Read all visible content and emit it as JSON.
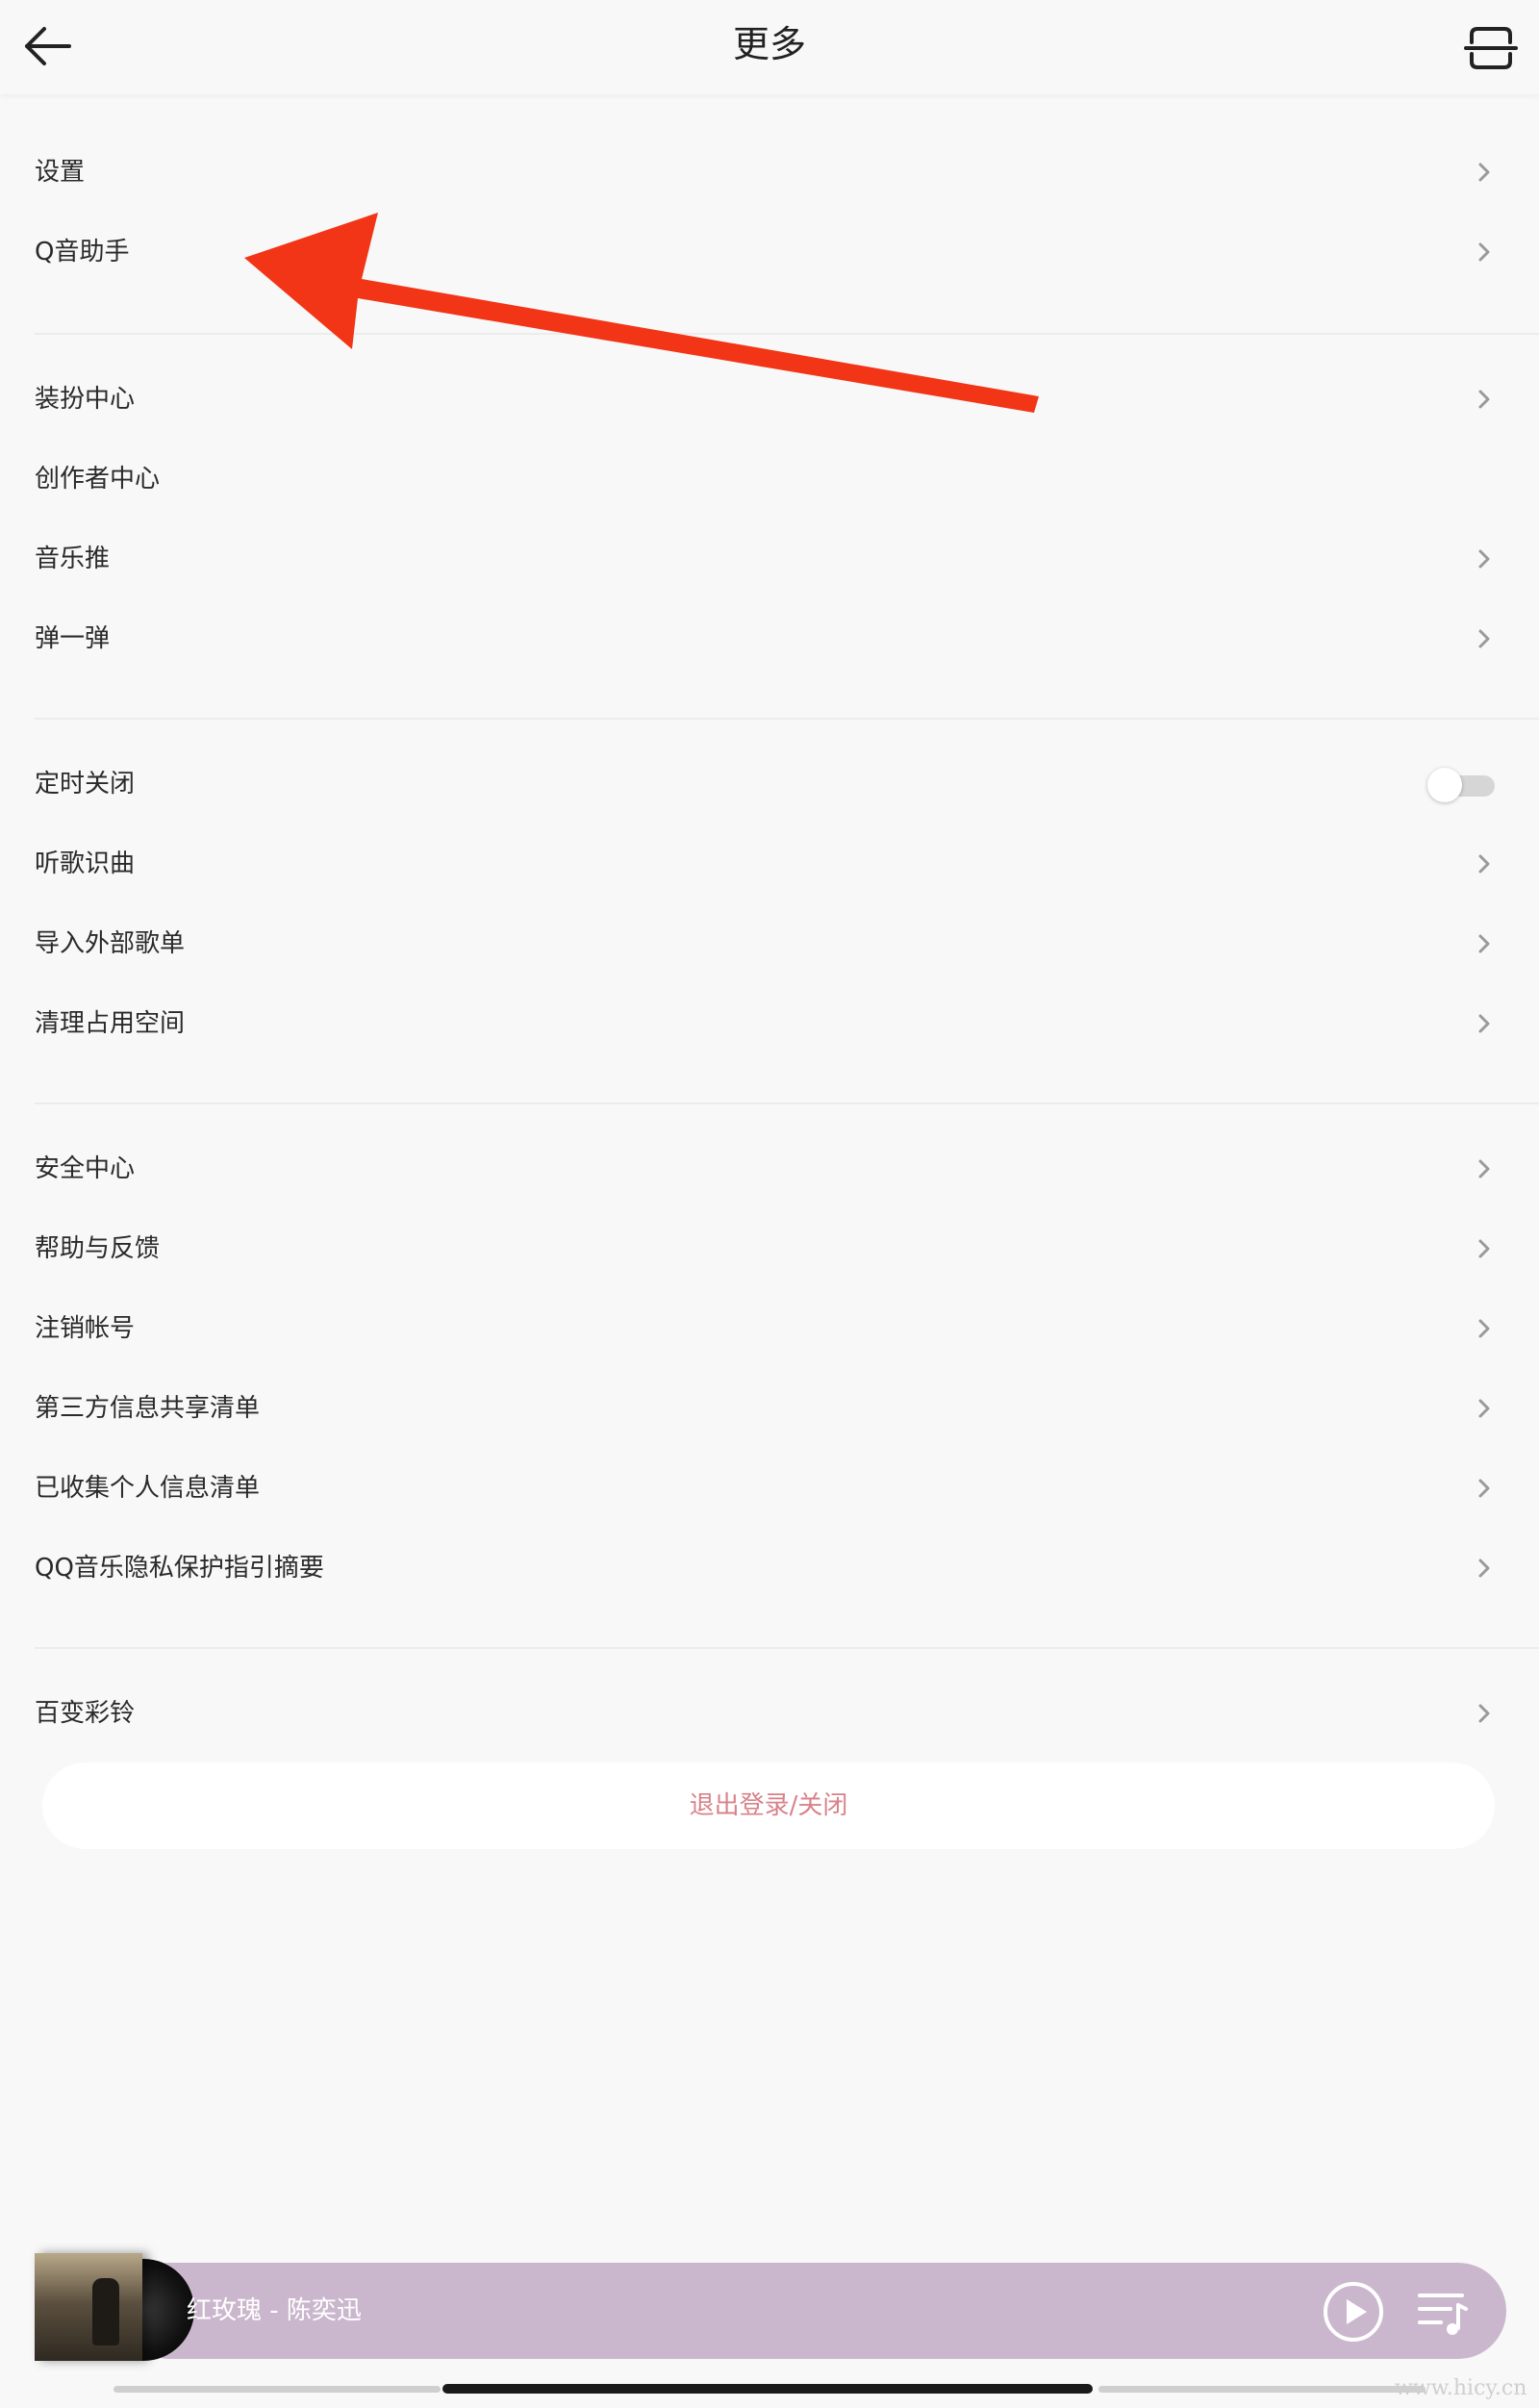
{
  "header": {
    "title": "更多",
    "back_icon": "arrow-left-icon",
    "scan_icon": "scan-icon"
  },
  "groups": [
    {
      "items": [
        {
          "label": "设置",
          "chevron": true
        },
        {
          "label": "Q音助手",
          "chevron": true
        }
      ]
    },
    {
      "items": [
        {
          "label": "装扮中心",
          "chevron": true
        },
        {
          "label": "创作者中心",
          "chevron": false
        },
        {
          "label": "音乐推",
          "chevron": true
        },
        {
          "label": "弹一弹",
          "chevron": true
        }
      ]
    },
    {
      "items": [
        {
          "label": "定时关闭",
          "toggle": true,
          "toggle_on": false
        },
        {
          "label": "听歌识曲",
          "chevron": true
        },
        {
          "label": "导入外部歌单",
          "chevron": true
        },
        {
          "label": "清理占用空间",
          "chevron": true
        }
      ]
    },
    {
      "items": [
        {
          "label": "安全中心",
          "chevron": true
        },
        {
          "label": "帮助与反馈",
          "chevron": true
        },
        {
          "label": "注销帐号",
          "chevron": true
        },
        {
          "label": "第三方信息共享清单",
          "chevron": true
        },
        {
          "label": "已收集个人信息清单",
          "chevron": true
        },
        {
          "label": "QQ音乐隐私保护指引摘要",
          "chevron": true
        }
      ]
    },
    {
      "items": [
        {
          "label": "百变彩铃",
          "chevron": true
        }
      ]
    }
  ],
  "logout_label": "退出登录/关闭",
  "player": {
    "song": "红玫瑰 - 陈奕迅",
    "play_icon": "play-circle-icon",
    "playlist_icon": "playlist-icon"
  },
  "watermark": "www.hicy.cn",
  "colors": {
    "background": "#f8f8f8",
    "divider": "#ececec",
    "logout_text": "#d8828a",
    "player_bar": "#cbb7cd",
    "annotation_arrow": "#f23517"
  }
}
